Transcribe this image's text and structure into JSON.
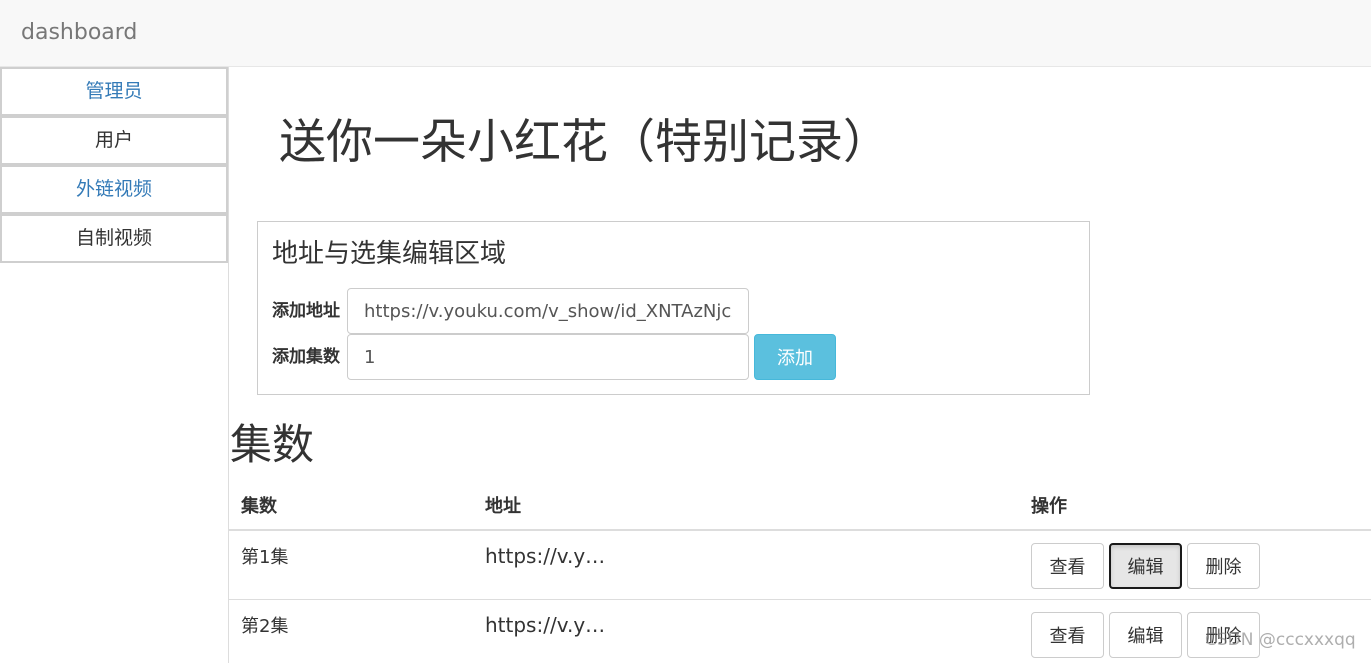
{
  "header": {
    "brand": "dashboard"
  },
  "sidebar": {
    "items": [
      {
        "label": "管理员"
      },
      {
        "label": "用户"
      },
      {
        "label": "外链视频"
      },
      {
        "label": "自制视频"
      }
    ]
  },
  "main": {
    "title": "送你一朵小红花（特别记录）",
    "editor": {
      "title": "地址与选集编辑区域",
      "address_label": "添加地址",
      "address_value": "https://v.youku.com/v_show/id_XNTAzNjcxM",
      "episode_label": "添加集数",
      "episode_value": "1",
      "add_button": "添加"
    },
    "episodes": {
      "title": "集数",
      "columns": [
        "集数",
        "地址",
        "操作"
      ],
      "rows": [
        {
          "episode": "第1集",
          "url": "https://v.yo…",
          "actions": [
            "查看",
            "编辑",
            "删除"
          ]
        },
        {
          "episode": "第2集",
          "url": "https://v.yo…",
          "actions": [
            "查看",
            "编辑",
            "删除"
          ]
        }
      ]
    }
  },
  "watermark": "CSDN @cccxxxqq",
  "colors": {
    "link": "#337ab7",
    "info_button": "#5bc0de",
    "navbar_bg": "#f8f8f8"
  }
}
